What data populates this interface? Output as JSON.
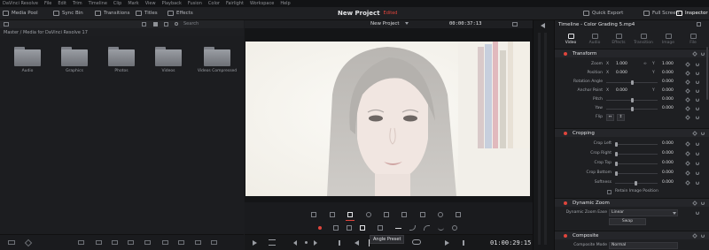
{
  "menu": [
    "DaVinci Resolve",
    "File",
    "Edit",
    "Trim",
    "Timeline",
    "Clip",
    "Mark",
    "View",
    "Playback",
    "Fusion",
    "Color",
    "Fairlight",
    "Workspace",
    "Help"
  ],
  "toolbar": {
    "media_pool": "Media Pool",
    "sync_bin": "Sync Bin",
    "transitions": "Transitions",
    "titles": "Titles",
    "effects": "Effects",
    "project_title": "New Project",
    "project_status": "Edited",
    "quick_export": "Quick Export",
    "full_screen": "Full Screen",
    "inspector": "Inspector"
  },
  "media_pool": {
    "search_placeholder": "Search",
    "breadcrumb": "Master / Media for DaVinci Resolve 17",
    "bins": [
      "Audio",
      "Graphics",
      "Photos",
      "Videos",
      "Videos Compressed"
    ]
  },
  "viewer": {
    "title": "New Project",
    "timecode_top": "00:00:37:13",
    "timecode_main": "01:00:29:15",
    "tooltip": "Angle Preset"
  },
  "inspector": {
    "clip_title": "Timeline - Color Grading 5.mp4",
    "tabs": [
      "Video",
      "Audio",
      "Effects",
      "Transition",
      "Image",
      "File"
    ],
    "transform": {
      "header": "Transform",
      "zoom_label": "Zoom",
      "zoom_x": "1.000",
      "zoom_y": "1.000",
      "position_label": "Position",
      "position_x": "0.000",
      "position_y": "0.000",
      "rotation_label": "Rotation Angle",
      "rotation": "0.000",
      "anchor_label": "Anchor Point",
      "anchor_x": "0.000",
      "anchor_y": "0.000",
      "pitch_label": "Pitch",
      "pitch": "0.000",
      "yaw_label": "Yaw",
      "yaw": "0.000",
      "flip_label": "Flip"
    },
    "cropping": {
      "header": "Cropping",
      "crop_left_label": "Crop Left",
      "crop_left": "0.000",
      "crop_right_label": "Crop Right",
      "crop_right": "0.000",
      "crop_top_label": "Crop Top",
      "crop_top": "0.000",
      "crop_bottom_label": "Crop Bottom",
      "crop_bottom": "0.000",
      "softness_label": "Softness",
      "softness": "0.000",
      "retain_label": "Retain Image Position"
    },
    "dynamic_zoom": {
      "header": "Dynamic Zoom",
      "ease_label": "Dynamic Zoom Ease",
      "ease_value": "Linear",
      "swap_label": "Swap"
    },
    "composite": {
      "header": "Composite",
      "mode_label": "Composite Mode",
      "mode_value": "Normal"
    }
  },
  "colors": {
    "accent_red": "#e0453c",
    "panel_bg": "#1e1f22"
  }
}
